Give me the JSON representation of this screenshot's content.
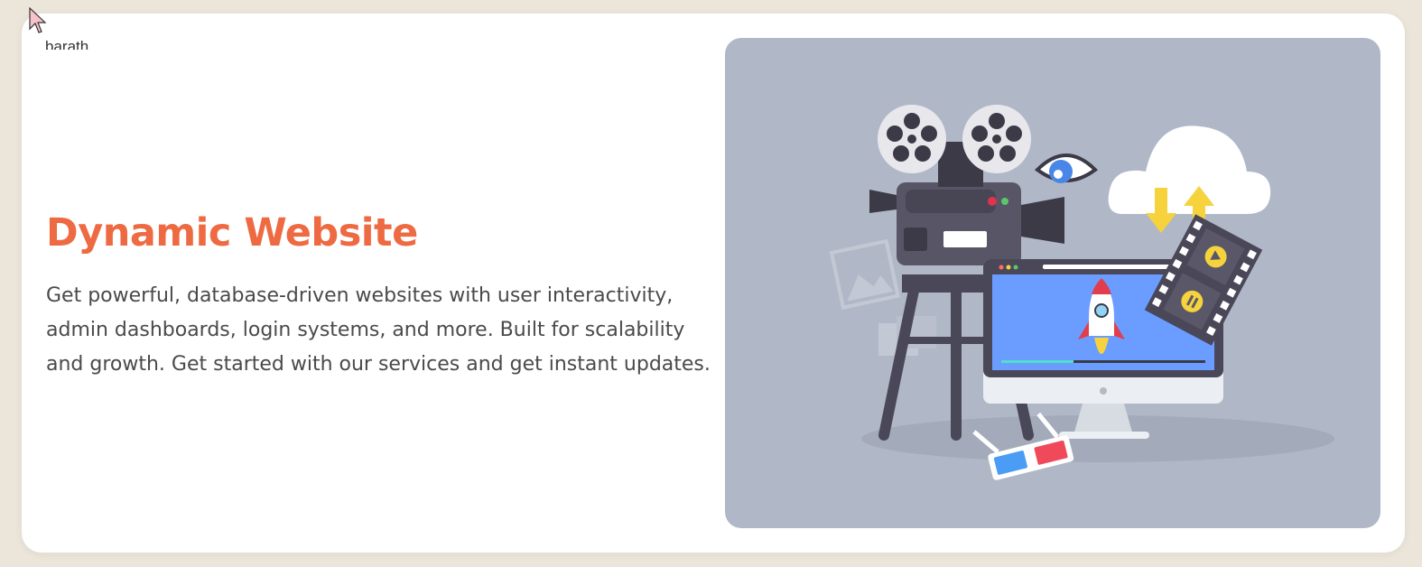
{
  "hero": {
    "clipped_text": "barath",
    "title": "Dynamic Website",
    "description": "Get powerful, database-driven websites with user interactivity, admin dashboards, login systems, and more. Built for scalability and growth. Get started with our services and get instant updates."
  },
  "colors": {
    "page_bg": "#ece6da",
    "card_bg": "#ffffff",
    "title": "#ee6a42",
    "body_text": "#4a4a4a",
    "illustration_bg": "#b0b8c7"
  },
  "icons": [
    "mouse-cursor-icon",
    "film-projector-icon",
    "eye-icon",
    "cloud-icon",
    "upload-arrow-icon",
    "download-arrow-icon",
    "film-strip-icon",
    "monitor-icon",
    "rocket-icon",
    "3d-glasses-icon",
    "photo-icon",
    "notes-icon"
  ]
}
